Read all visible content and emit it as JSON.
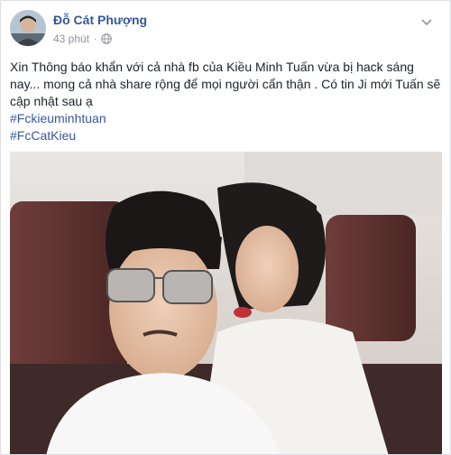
{
  "post": {
    "author": "Đỗ Cát Phượng",
    "time": "43 phút",
    "privacy_icon": "globe-icon",
    "text": "Xin Thông báo khẩn với cả nhà fb của Kiều Minh Tuấn vừa bị hack sáng nay... mong cả nhà share rộng để mọi người cẩn thận . Có tin Ji mới Tuấn sẽ cập nhật sau ạ",
    "hashtags": [
      "#Fckieuminhtuan",
      "#FcCatKieu"
    ]
  },
  "colors": {
    "author_link": "#365899",
    "text": "#1d2129",
    "meta": "#90949c",
    "background": "#e9ebee"
  }
}
